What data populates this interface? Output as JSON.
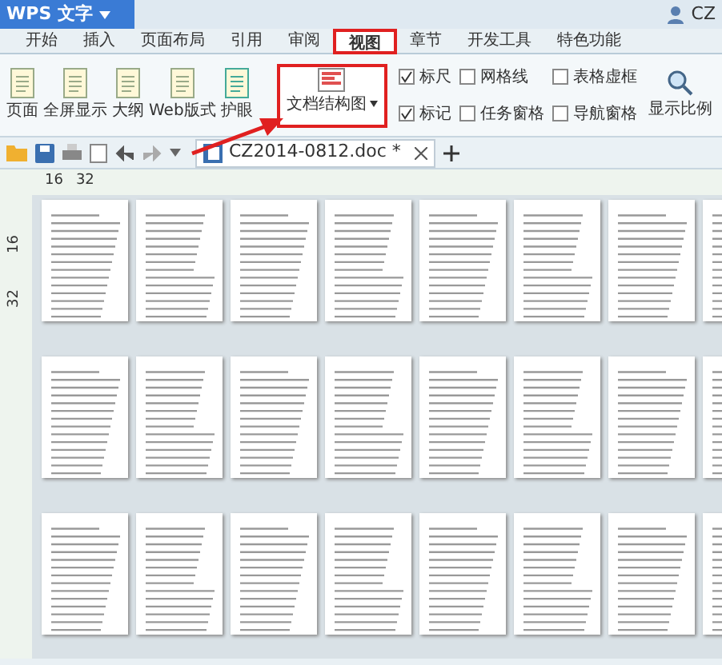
{
  "app_button": {
    "label": "WPS 文字"
  },
  "user": {
    "label": "CZ"
  },
  "tabs": [
    {
      "label": "开始",
      "selected": false
    },
    {
      "label": "插入",
      "selected": false
    },
    {
      "label": "页面布局",
      "selected": false
    },
    {
      "label": "引用",
      "selected": false
    },
    {
      "label": "审阅",
      "selected": false
    },
    {
      "label": "视图",
      "selected": true
    },
    {
      "label": "章节",
      "selected": false
    },
    {
      "label": "开发工具",
      "selected": false
    },
    {
      "label": "特色功能",
      "selected": false
    }
  ],
  "ribbon": {
    "view_buttons": [
      {
        "label": "页面"
      },
      {
        "label": "全屏显示"
      },
      {
        "label": "大纲"
      },
      {
        "label": "Web版式"
      },
      {
        "label": "护眼"
      }
    ],
    "doc_map_button": {
      "label": "文档结构图"
    },
    "checkboxes": [
      {
        "label": "标尺",
        "checked": true
      },
      {
        "label": "网格线",
        "checked": false
      },
      {
        "label": "表格虚框",
        "checked": false
      },
      {
        "label": "标记",
        "checked": true
      },
      {
        "label": "任务窗格",
        "checked": false
      },
      {
        "label": "导航窗格",
        "checked": false
      }
    ],
    "zoom_button": {
      "label": "显示比例"
    }
  },
  "document_tab": {
    "title": "CZ2014-0812.doc *"
  },
  "ruler": {
    "top_marks": [
      "16",
      "32"
    ],
    "side_marks": [
      "16",
      "32"
    ]
  }
}
